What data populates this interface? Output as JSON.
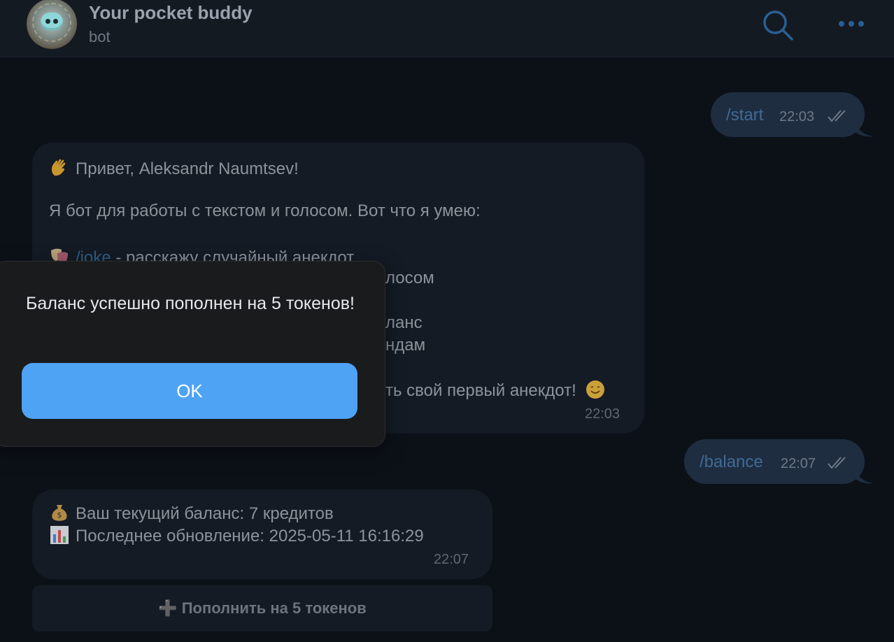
{
  "header": {
    "title": "Your pocket buddy",
    "subtitle": "bot",
    "icons": [
      "search-icon",
      "more-icon"
    ]
  },
  "messages": {
    "start": {
      "text": "/start",
      "time": "22:03",
      "status": "read-double-check"
    },
    "welcome": {
      "greeting": "Привет, Aleksandr Naumtsev!",
      "intro": "Я бот для работы с текстом и голосом. Вот что я умею:",
      "joke_command": "/joke",
      "joke_desc": " - расскажу случайный анекдот",
      "line_voice_tail": "лосом",
      "line_balance_tail": "ланс",
      "line_help_tail": "ндам",
      "line_cta_tail": "ть свой первый анекдот!",
      "time": "22:03"
    },
    "balance_cmd": {
      "text": "/balance",
      "time": "22:07",
      "status": "read-double-check"
    },
    "balance_reply": {
      "line1": "Ваш текущий баланс: 7 кредитов",
      "line2": "Последнее обновление: 2025-05-11 16:16:29",
      "time": "22:07"
    }
  },
  "keyboard": {
    "topup_label": "➕ Пополнить на 5 токенов"
  },
  "alert": {
    "message": "Баланс успешно пополнен на 5 токенов!",
    "ok_label": "OK"
  },
  "colors": {
    "background": "#0c1118",
    "outgoing_bubble": "#1f2d40",
    "incoming_bubble": "#141b24",
    "accent_blue": "#4fa3f5",
    "alert_bg": "#1a1b1d"
  }
}
